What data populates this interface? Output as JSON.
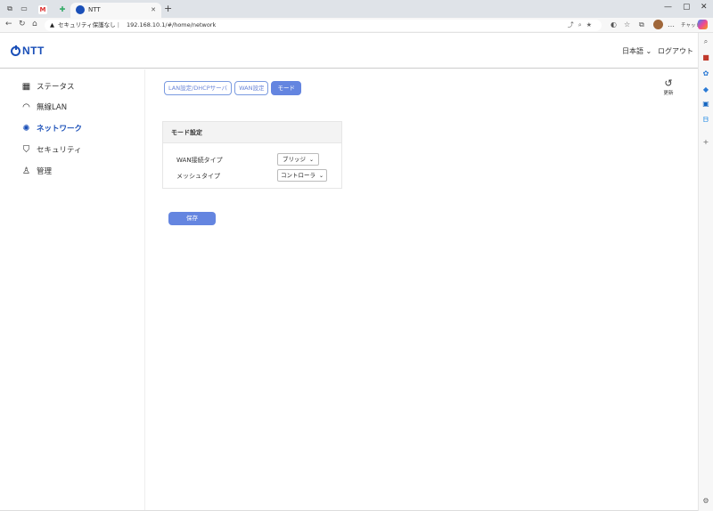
{
  "browser": {
    "tabs": [
      {
        "label": ""
      },
      {
        "label": ""
      },
      {
        "label": "NTT"
      }
    ],
    "address": {
      "security_label": "セキュリティ保護なし",
      "url": "192.168.10.1/#/home/network"
    },
    "chat_label": "チャット"
  },
  "header": {
    "logo_text": "NTT",
    "language": "日本語",
    "language_chevron": "⌄",
    "logout": "ログアウト"
  },
  "nav": {
    "items": [
      {
        "label": "ステータス",
        "icon": "dashboard-icon",
        "active": false
      },
      {
        "label": "無線LAN",
        "icon": "wifi-icon",
        "active": false
      },
      {
        "label": "ネットワーク",
        "icon": "network-icon",
        "active": true
      },
      {
        "label": "セキュリティ",
        "icon": "shield-icon",
        "active": false
      },
      {
        "label": "管理",
        "icon": "user-icon",
        "active": false
      }
    ]
  },
  "tabs": [
    {
      "label": "LAN設定/DHCPサーバ",
      "selected": false
    },
    {
      "label": "WAN設定",
      "selected": false
    },
    {
      "label": "モード",
      "selected": true
    }
  ],
  "refresh": {
    "label": "更新"
  },
  "mode_card": {
    "title": "モード設定",
    "wan_label": "WAN接続タイプ",
    "wan_value": "ブリッジ",
    "mesh_label": "メッシュタイプ",
    "mesh_value": "コントローラ"
  },
  "save_label": "保存",
  "colors": {
    "brand": "#1a4fb8",
    "accent": "#6485e0"
  }
}
